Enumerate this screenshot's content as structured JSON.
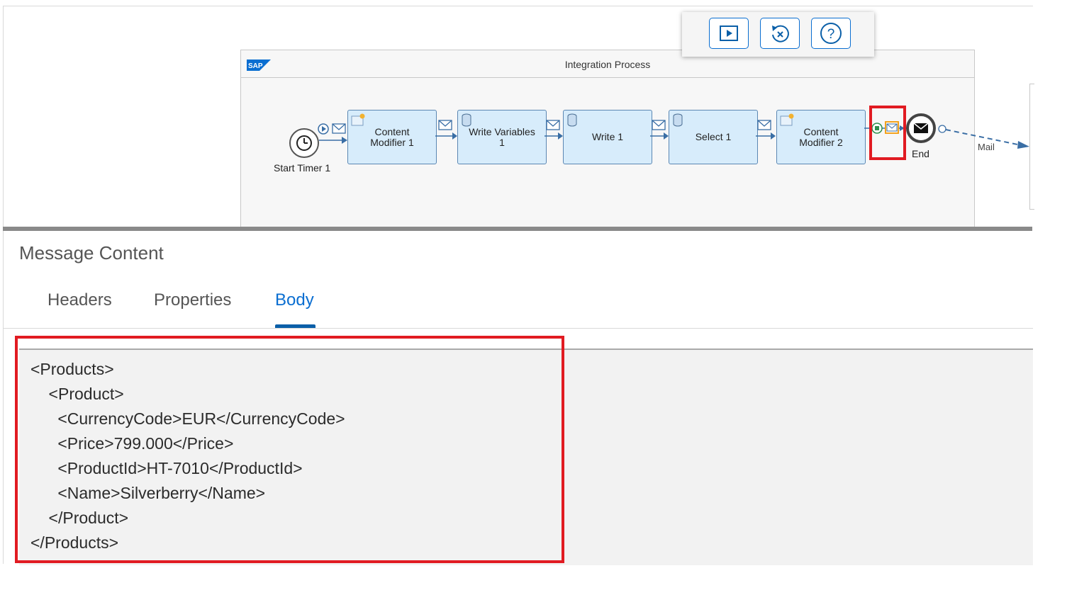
{
  "toolbar": {
    "buttons": [
      {
        "name": "run-icon"
      },
      {
        "name": "reset-icon"
      },
      {
        "name": "help-icon"
      }
    ]
  },
  "process": {
    "title": "Integration Process",
    "start_label": "Start Timer 1",
    "steps": [
      {
        "label": "Content\nModifier 1"
      },
      {
        "label": "Write Variables\n1"
      },
      {
        "label": "Write 1"
      },
      {
        "label": "Select 1"
      },
      {
        "label": "Content\nModifier 2"
      }
    ],
    "end_label": "End",
    "mail_label": "Mail"
  },
  "message": {
    "title": "Message Content",
    "tabs": [
      "Headers",
      "Properties",
      "Body"
    ],
    "active_tab": "Body",
    "body": "<Products>\n    <Product>\n      <CurrencyCode>EUR</CurrencyCode>\n      <Price>799.000</Price>\n      <ProductId>HT-7010</ProductId>\n      <Name>Silverberry</Name>\n    </Product>\n</Products>"
  },
  "colors": {
    "accent": "#0a6ed1",
    "highlight": "#e11b22",
    "step_fill": "#d7ecfb"
  }
}
